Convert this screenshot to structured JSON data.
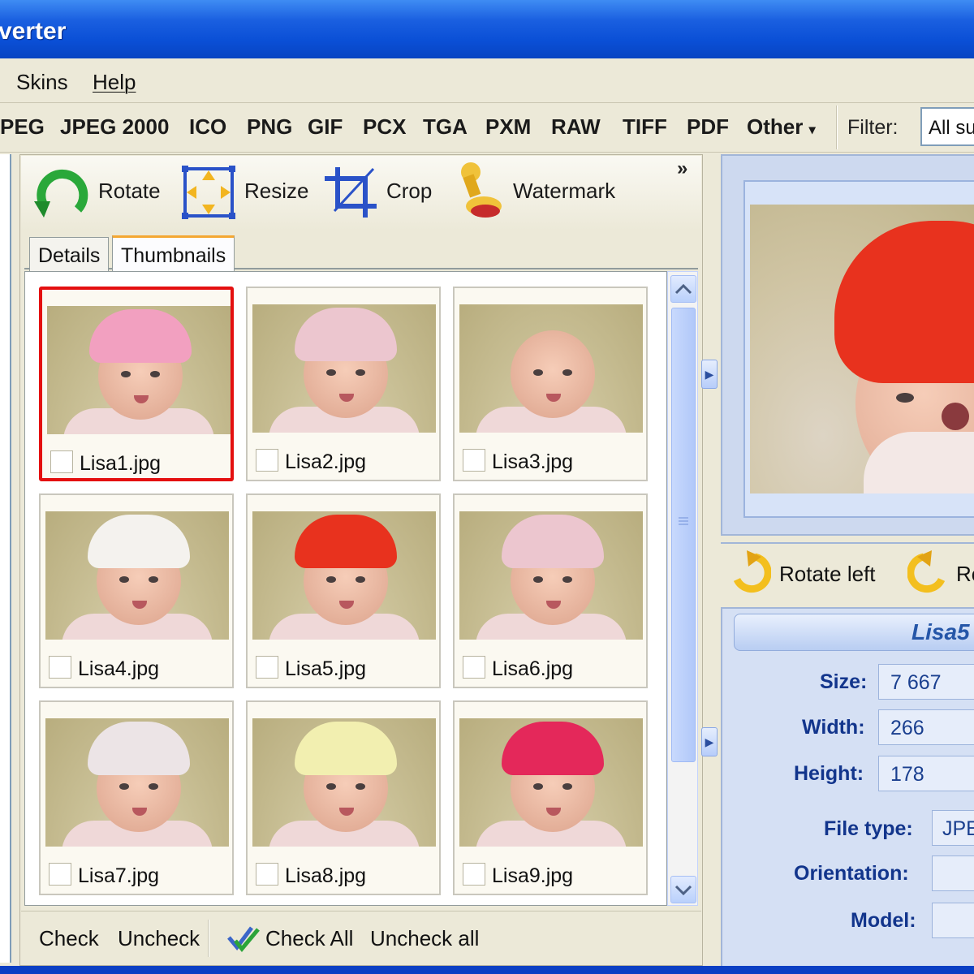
{
  "window": {
    "title": "verter"
  },
  "menu": {
    "items": [
      "Skins",
      "Help"
    ]
  },
  "formats": {
    "items": [
      "PEG",
      "JPEG 2000",
      "ICO",
      "PNG",
      "GIF",
      "PCX",
      "TGA",
      "PXM",
      "RAW",
      "TIFF",
      "PDF"
    ],
    "other_label": "Other",
    "other_arrow": "▾"
  },
  "filter": {
    "label": "Filter:",
    "value": "All su"
  },
  "toolbar": {
    "rotate": "Rotate",
    "resize": "Resize",
    "crop": "Crop",
    "watermark": "Watermark",
    "more": "»"
  },
  "tabs": {
    "details": "Details",
    "thumbnails": "Thumbnails",
    "active": "Thumbnails"
  },
  "thumbnails": [
    {
      "name": "Lisa1.jpg",
      "hat_color": "#f2a0c0",
      "selected": true
    },
    {
      "name": "Lisa2.jpg",
      "hat_color": "#ecc6cf",
      "selected": false
    },
    {
      "name": "Lisa3.jpg",
      "hat_color": "none",
      "selected": false
    },
    {
      "name": "Lisa4.jpg",
      "hat_color": "#f4f2ee",
      "selected": false
    },
    {
      "name": "Lisa5.jpg",
      "hat_color": "#e8321e",
      "selected": false
    },
    {
      "name": "Lisa6.jpg",
      "hat_color": "#ecc6cf",
      "selected": false
    },
    {
      "name": "Lisa7.jpg",
      "hat_color": "#ece4e6",
      "selected": false
    },
    {
      "name": "Lisa8.jpg",
      "hat_color": "#f2efb0",
      "selected": false
    },
    {
      "name": "Lisa9.jpg",
      "hat_color": "#e4285a",
      "selected": false
    }
  ],
  "bottom": {
    "check": "Check",
    "uncheck": "Uncheck",
    "check_all": "Check All",
    "uncheck_all": "Uncheck all"
  },
  "preview": {
    "hat_color": "#e8321e"
  },
  "rotate": {
    "left": "Rotate left",
    "right": "Ro"
  },
  "info": {
    "filename": "Lisa5",
    "size_label": "Size:",
    "size_value": "7 667",
    "width_label": "Width:",
    "width_value": "266",
    "height_label": "Height:",
    "height_value": "178",
    "filetype_label": "File type:",
    "filetype_value": "JPE",
    "orientation_label": "Orientation:",
    "orientation_value": "",
    "model_label": "Model:",
    "model_value": ""
  },
  "colors": {
    "title_blue": "#0a4fd6",
    "selection_red": "#e41010",
    "panel_beige": "#ece9d8",
    "info_blue": "#12358c"
  }
}
